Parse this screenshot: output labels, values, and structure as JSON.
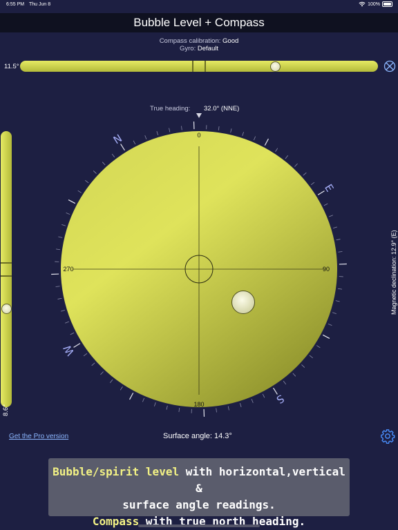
{
  "status_bar": {
    "time": "6:55 PM",
    "date": "Thu Jun 8",
    "battery": "100%"
  },
  "header": {
    "title": "Bubble Level + Compass"
  },
  "calibration": {
    "compass_label": "Compass calibration:",
    "compass_value": "Good",
    "gyro_label": "Gyro:",
    "gyro_value": "Default"
  },
  "horizontal_level": {
    "angle": "11.5°",
    "bubble_position": 0.72
  },
  "vertical_level": {
    "angle": "8.6°",
    "bubble_position": 0.65
  },
  "heading": {
    "label": "True heading:",
    "value": "32.0° (NNE)",
    "degrees": 32.0
  },
  "compass": {
    "dial_labels": {
      "top": "0",
      "right": "90",
      "bottom": "180",
      "left": "270"
    },
    "cardinals": {
      "n": "N",
      "e": "E",
      "s": "S",
      "w": "W"
    }
  },
  "declination": {
    "label": "Magnetic declination: 12.9° (E)"
  },
  "surface_angle": {
    "label": "Surface angle: 14.3°"
  },
  "pro_link": {
    "label": "Get the Pro version"
  },
  "promo": {
    "line1_hl": "Bubble/spirit level",
    "line1_rest": " with horizontal,vertical &",
    "line2": "surface angle readings.",
    "line3_hl": "Compass",
    "line3_rest": " with true north heading."
  },
  "colors": {
    "background": "#1d1f42",
    "level_yellow": "#e0e35a",
    "cardinal_blue": "#a6aef8"
  }
}
